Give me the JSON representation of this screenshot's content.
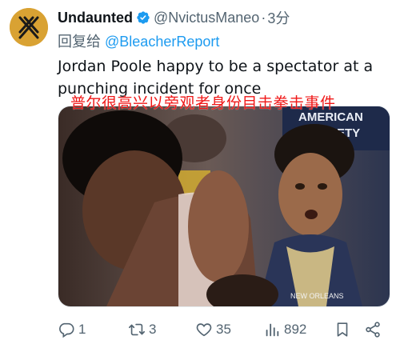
{
  "tweet": {
    "author_name": "Undaunted",
    "author_handle": "@NvictusManeo",
    "separator": "·",
    "time": "3分",
    "reply_prefix": "回复给 ",
    "reply_to": "@BleacherReport",
    "text": "Jordan Poole happy to be a spectator at a punching incident for once",
    "overlay_caption": "普尔很高兴以旁观者身份目击拳击事件",
    "media": {
      "banner_text_1": "AMERICAN",
      "banner_text_2": "ETY",
      "jersey_text": "NEW ORLEANS"
    }
  },
  "actions": {
    "replies": "1",
    "retweets": "3",
    "likes": "35",
    "views": "892"
  },
  "colors": {
    "accent": "#1d9bf0",
    "muted": "#536471",
    "avatar": "#d9a233",
    "overlay_text": "#f01818"
  }
}
